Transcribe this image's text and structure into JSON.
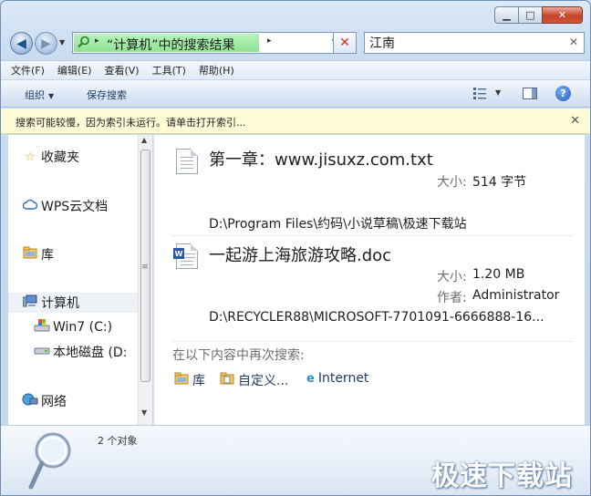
{
  "window": {
    "minimize": "▁",
    "maximize": "□",
    "close": "✕"
  },
  "nav": {
    "back_icon": "◀",
    "forward_icon": "▶"
  },
  "address": {
    "crumb": "“计算机”中的搜索结果",
    "highlight_color": "#8ee394"
  },
  "search": {
    "value": "江南"
  },
  "menu": [
    "文件(F)",
    "编辑(E)",
    "查看(V)",
    "工具(T)",
    "帮助(H)"
  ],
  "toolbar": {
    "organize": "组织",
    "save_search": "保存搜索",
    "help": "?"
  },
  "infobar": {
    "message": "搜索可能较慢，因为索引未运行。请单击打开索引...",
    "background": "#fffbd7"
  },
  "sidebar": {
    "items": [
      {
        "label": "收藏夹",
        "icon": "star-icon"
      },
      {
        "label": "WPS云文档",
        "icon": "cloud-icon"
      },
      {
        "label": "库",
        "icon": "library-icon"
      },
      {
        "label": "计算机",
        "icon": "computer-icon"
      },
      {
        "label": "Win7 (C:)",
        "icon": "drive-c-icon"
      },
      {
        "label": "本地磁盘 (D:",
        "icon": "drive-d-icon"
      },
      {
        "label": "网络",
        "icon": "network-icon"
      }
    ]
  },
  "results": [
    {
      "name": "第一章：www.jisuxz.com.txt",
      "size_label": "大小:",
      "size": "514 字节",
      "path": "D:\\Program Files\\约码\\小说草稿\\极速下载站"
    },
    {
      "name": "一起游上海旅游攻略.doc",
      "size_label": "大小:",
      "size": "1.20 MB",
      "author_label": "作者:",
      "author": "Administrator",
      "path": "D:\\RECYCLER88\\MICROSOFT-7701091-6666888-16..."
    }
  ],
  "search_again": {
    "label": "在以下内容中再次搜索:",
    "options": [
      "库",
      "自定义...",
      "Internet"
    ]
  },
  "details": {
    "count": "2 个对象"
  },
  "watermark": "极速下载站"
}
